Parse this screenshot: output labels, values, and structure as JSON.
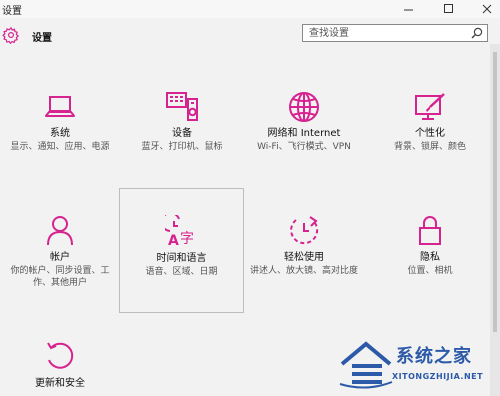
{
  "window": {
    "title": "设置"
  },
  "header": {
    "title": "设置"
  },
  "search": {
    "placeholder": "查找设置"
  },
  "tiles": [
    {
      "id": "system",
      "name": "系统",
      "desc": "显示、通知、应用、电源",
      "icon": "laptop-icon"
    },
    {
      "id": "devices",
      "name": "设备",
      "desc": "蓝牙、打印机、鼠标",
      "icon": "devices-icon"
    },
    {
      "id": "network",
      "name": "网络和 Internet",
      "desc": "Wi-Fi、飞行模式、VPN",
      "icon": "globe-icon"
    },
    {
      "id": "personalization",
      "name": "个性化",
      "desc": "背景、锁屏、颜色",
      "icon": "paint-icon"
    },
    {
      "id": "accounts",
      "name": "帐户",
      "desc": "你的帐户、同步设置、工作、其他用户",
      "icon": "person-icon"
    },
    {
      "id": "time",
      "name": "时间和语言",
      "desc": "语音、区域、日期",
      "icon": "time-language-icon"
    },
    {
      "id": "ease",
      "name": "轻松使用",
      "desc": "讲述人、放大镜、高对比度",
      "icon": "ease-of-access-icon"
    },
    {
      "id": "privacy",
      "name": "隐私",
      "desc": "位置、相机",
      "icon": "lock-icon"
    },
    {
      "id": "update",
      "name": "更新和安全",
      "desc": "",
      "icon": "refresh-icon"
    }
  ],
  "colors": {
    "accent": "#d6238f",
    "background": "#f2f2f2"
  },
  "watermark": {
    "title": "系统之家",
    "subtitle": "XITONGZHIJIA.NET"
  }
}
